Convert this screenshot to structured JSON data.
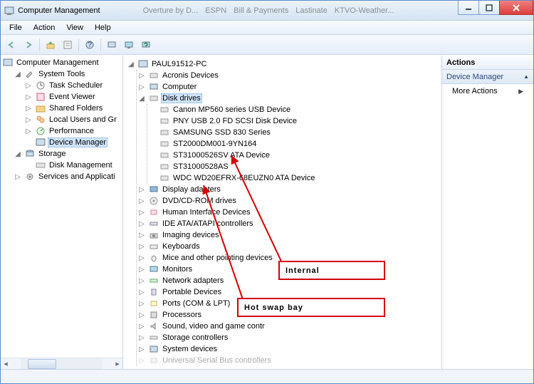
{
  "window": {
    "title": "Computer Management"
  },
  "bg_tabs": [
    "Overture by D...",
    "ESPN",
    "Bill & Payments",
    "Lastinate",
    "KTVO-Weather..."
  ],
  "menu": {
    "file": "File",
    "action": "Action",
    "view": "View",
    "help": "Help"
  },
  "toolbar_icons": [
    "back",
    "forward",
    "up",
    "props",
    "cut",
    "help",
    "pc",
    "monitor",
    "refresh"
  ],
  "left_tree": {
    "root": "Computer Management",
    "system_tools": "System Tools",
    "task_scheduler": "Task Scheduler",
    "event_viewer": "Event Viewer",
    "shared_folders": "Shared Folders",
    "local_users": "Local Users and Gr",
    "performance": "Performance",
    "device_manager": "Device Manager",
    "storage": "Storage",
    "disk_management": "Disk Management",
    "services": "Services and Applicati"
  },
  "center_tree": {
    "root": "PAUL91512-PC",
    "acronis": "Acronis Devices",
    "computer": "Computer",
    "disk_drives": "Disk drives",
    "drives": [
      "Canon MP560 series USB Device",
      "PNY USB 2.0 FD SCSI Disk Device",
      "SAMSUNG SSD 830 Series",
      "ST2000DM001-9YN164",
      "ST31000526SV ATA Device",
      "ST31000528AS",
      "WDC WD20EFRX-68EUZN0 ATA Device"
    ],
    "display": "Display adapters",
    "dvd": "DVD/CD-ROM drives",
    "hid": "Human Interface Devices",
    "ide": "IDE ATA/ATAPI controllers",
    "imaging": "Imaging devices",
    "keyboards": "Keyboards",
    "mice": "Mice and other pointing devices",
    "monitors": "Monitors",
    "network": "Network adapters",
    "portable": "Portable Devices",
    "ports": "Ports (COM & LPT)",
    "processors": "Processors",
    "sound": "Sound, video and game contr",
    "storage_ctrl": "Storage controllers",
    "system_dev": "System devices",
    "usb": "Universal Serial Bus controllers"
  },
  "actions": {
    "head": "Actions",
    "group": "Device Manager",
    "more": "More Actions"
  },
  "annotations": {
    "internal": "Internal",
    "hotswap": "Hot swap bay"
  }
}
